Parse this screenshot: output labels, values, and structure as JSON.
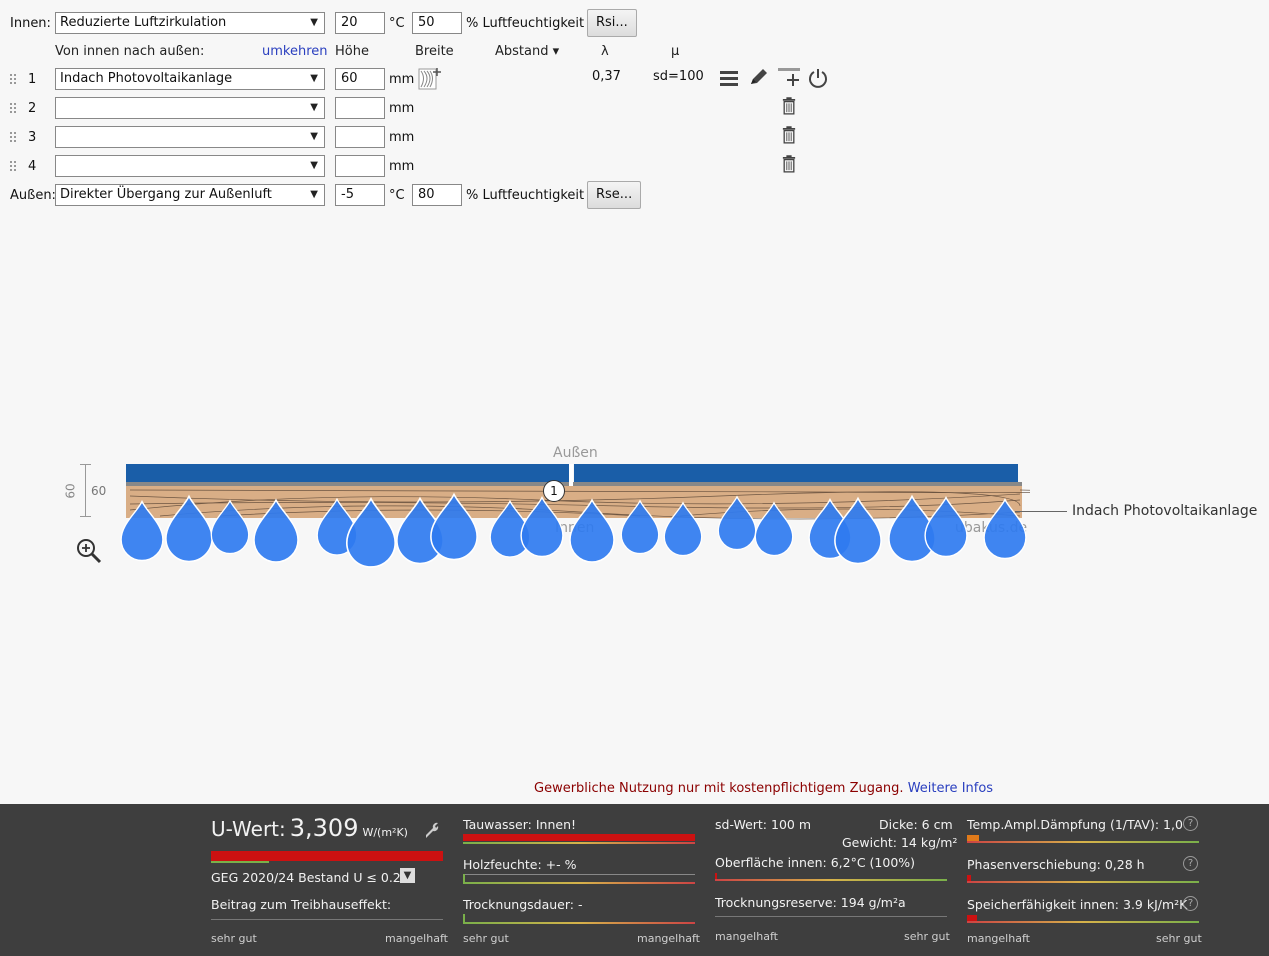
{
  "inside": {
    "label": "Innen:",
    "select": "Reduzierte Luftzirkulation",
    "temp": "20",
    "temp_unit": "°C",
    "humidity": "50",
    "humidity_label": "% Luftfeuchtigkeit",
    "button": "Rsi..."
  },
  "header": {
    "direction": "Von innen nach außen:",
    "reverse": "umkehren",
    "height": "Höhe",
    "width": "Breite",
    "spacing": "Abstand ▾",
    "lambda": "λ",
    "mu": "μ"
  },
  "layers": [
    {
      "num": "1",
      "material": "Indach Photovoltaikanlage",
      "thickness": "60",
      "unit": "mm",
      "lambda": "0,37",
      "mu": "sd=100"
    },
    {
      "num": "2",
      "material": "",
      "thickness": "",
      "unit": "mm"
    },
    {
      "num": "3",
      "material": "",
      "thickness": "",
      "unit": "mm"
    },
    {
      "num": "4",
      "material": "",
      "thickness": "",
      "unit": "mm"
    }
  ],
  "outside": {
    "label": "Außen:",
    "select": "Direkter Übergang zur Außenluft",
    "temp": "-5",
    "temp_unit": "°C",
    "humidity": "80",
    "humidity_label": "% Luftfeuchtigkeit",
    "button": "Rse..."
  },
  "diagram": {
    "outside_label": "Außen",
    "inside_label": "Innen",
    "dimension": "60",
    "dimension_rot": "60",
    "layer_marker": "1",
    "layer_callout": "Indach Photovoltaikanlage",
    "watermark": "ubakus.de"
  },
  "notice": {
    "text": "Gewerbliche Nutzung nur mit kostenpflichtigem Zugang.",
    "link": "Weitere Infos"
  },
  "results": {
    "u_label": "U-Wert:",
    "u_value": "3,309",
    "u_unit": "W/(m²K)",
    "geg": "GEG 2020/24 Bestand U ≤ 0.24",
    "greenhouse": "Beitrag zum Treibhauseffekt:",
    "scale_good": "sehr gut",
    "scale_bad": "mangelhaft",
    "condensate": "Tauwasser: Innen!",
    "wood_moisture": "Holzfeuchte: +- %",
    "drying": "Trocknungsdauer: -",
    "sd": "sd-Wert: 100 m",
    "thickness": "Dicke: 6 cm",
    "weight": "Gewicht: 14 kg/m²",
    "surface": "Oberfläche innen: 6,2°C (100%)",
    "drying_reserve": "Trocknungsreserve: 194 g/m²a",
    "scale_bad2": "mangelhaft",
    "scale_good2": "sehr gut",
    "damping": "Temp.Ampl.Dämpfung (1/TAV): 1,0",
    "phase": "Phasenverschiebung: 0,28 h",
    "storage": "Speicherfähigkeit innen: 3.9 kJ/m²K",
    "scale_bad3": "mangelhaft",
    "scale_good3": "sehr gut",
    "help": "?"
  },
  "colors": {
    "link": "#2a3fbf",
    "notice": "#8b0000",
    "panel": "#1a5ea8",
    "wood": "#d9ae86",
    "drop": "#2f7bf0",
    "bad_bar": "#cc1111",
    "footer": "#3e3e3e"
  }
}
